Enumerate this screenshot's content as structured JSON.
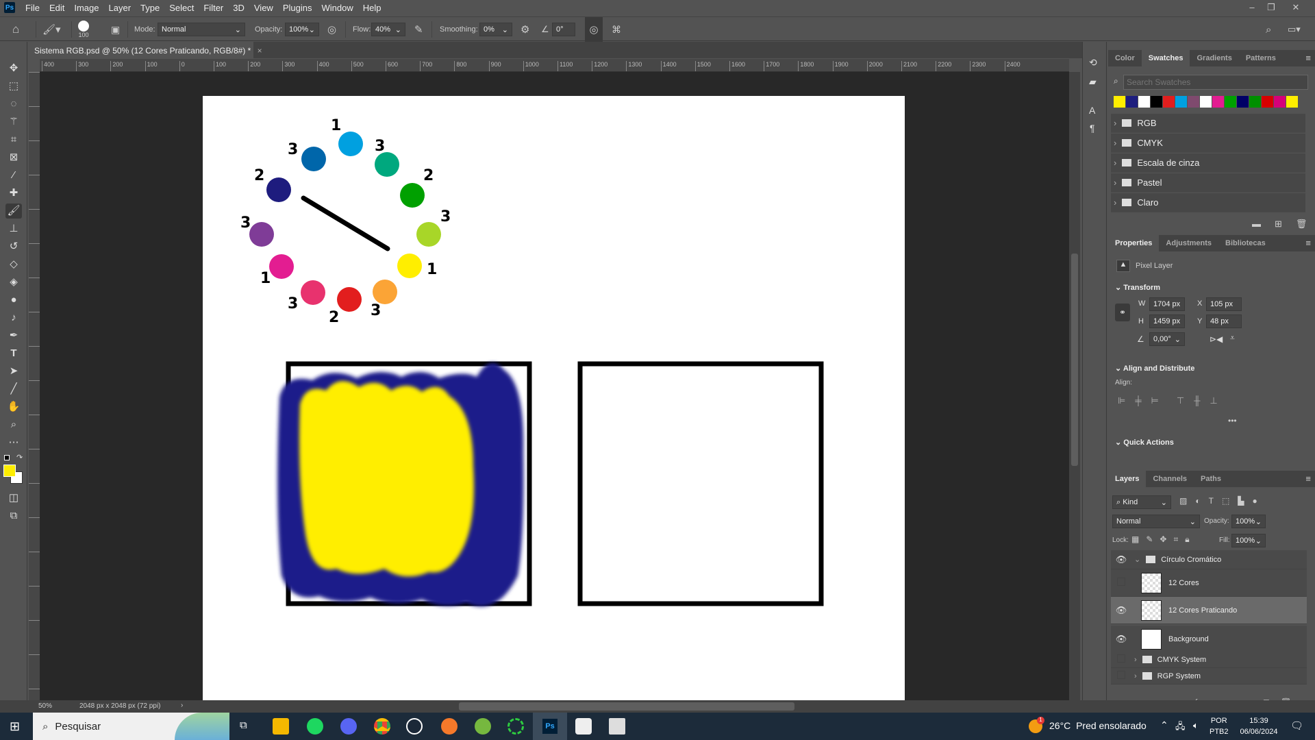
{
  "app": {
    "logo": "Ps",
    "menu": [
      "File",
      "Edit",
      "Image",
      "Layer",
      "Type",
      "Select",
      "Filter",
      "3D",
      "View",
      "Plugins",
      "Window",
      "Help"
    ]
  },
  "options": {
    "brush_size": "100",
    "mode_label": "Mode:",
    "mode": "Normal",
    "opacity_label": "Opacity:",
    "opacity": "100%",
    "flow_label": "Flow:",
    "flow": "40%",
    "smoothing_label": "Smoothing:",
    "smoothing": "0%",
    "angle": "0°"
  },
  "document": {
    "tab_title": "Sistema RGB.psd @ 50% (12 Cores Praticando, RGB/8#) *",
    "zoom": "50%",
    "info": "2048 px x 2048 px (72 ppi)"
  },
  "ruler": {
    "h_labels": [
      "400",
      "300",
      "200",
      "100",
      "0",
      "100",
      "200",
      "300",
      "400",
      "500",
      "600",
      "700",
      "800",
      "900",
      "1000",
      "1100",
      "1200",
      "1300",
      "1400",
      "1500",
      "1600",
      "1700",
      "1800",
      "1900",
      "2000",
      "2100",
      "2200",
      "2300",
      "2400"
    ]
  },
  "canvas": {
    "wheel": [
      {
        "color": "#00a0e0",
        "label": "1"
      },
      {
        "color": "#00a87e",
        "label": "3"
      },
      {
        "color": "#00a000",
        "label": "2"
      },
      {
        "color": "#a8d628",
        "label": "3"
      },
      {
        "color": "#ffee00",
        "label": "1"
      },
      {
        "color": "#fba436",
        "label": "3"
      },
      {
        "color": "#e21e1e",
        "label": "2"
      },
      {
        "color": "#e8326e",
        "label": "3"
      },
      {
        "color": "#e31d91",
        "label": "1"
      },
      {
        "color": "#7f3c97",
        "label": "3"
      },
      {
        "color": "#1e1c7e",
        "label": "2"
      },
      {
        "color": "#0066aa",
        "label": "3"
      }
    ],
    "paint_colors": {
      "primary": "#ffee00",
      "secondary": "#1e1e8a"
    }
  },
  "swatches_panel": {
    "tabs": [
      "Color",
      "Swatches",
      "Gradients",
      "Patterns"
    ],
    "active": "Swatches",
    "search_placeholder": "Search Swatches",
    "colors": [
      "#ffee00",
      "#1e1e7e",
      "#ffffff",
      "#000000",
      "#e21e1e",
      "#00a0e0",
      "#7f4a6e",
      "#ffffff",
      "#e31d91",
      "#00a000",
      "#000066",
      "#008f00",
      "#d80000",
      "#d6007a",
      "#ffee00"
    ],
    "groups": [
      "RGB",
      "CMYK",
      "Escala de cinza",
      "Pastel",
      "Claro"
    ]
  },
  "properties_panel": {
    "tabs": [
      "Properties",
      "Adjustments",
      "Bibliotecas"
    ],
    "active": "Properties",
    "layer_type": "Pixel Layer",
    "transform_title": "Transform",
    "w_label": "W",
    "w": "1704 px",
    "h_label": "H",
    "h": "1459 px",
    "x_label": "X",
    "x": "105 px",
    "y_label": "Y",
    "y": "48 px",
    "angle": "0,00°",
    "align_title": "Align and Distribute",
    "align_label": "Align:",
    "quick_actions": "Quick Actions"
  },
  "layers_panel": {
    "tabs": [
      "Layers",
      "Channels",
      "Paths"
    ],
    "active": "Layers",
    "kind": "Kind",
    "blend": "Normal",
    "opacity_label": "Opacity:",
    "opacity": "100%",
    "lock_label": "Lock:",
    "fill_label": "Fill:",
    "fill": "100%",
    "layers": [
      {
        "name": "Círculo Cromático",
        "type": "group",
        "visible": true,
        "expanded": true
      },
      {
        "name": "12 Cores",
        "type": "pixel",
        "visible": false
      },
      {
        "name": "12 Cores Praticando",
        "type": "pixel",
        "visible": true,
        "selected": true
      },
      {
        "name": "Background",
        "type": "pixel",
        "visible": true
      },
      {
        "name": "CMYK System",
        "type": "group",
        "visible": false
      },
      {
        "name": "RGP System",
        "type": "group",
        "visible": false
      }
    ]
  },
  "taskbar": {
    "search_placeholder": "Pesquisar",
    "weather_temp": "26°C",
    "weather_text": "Pred ensolarado",
    "weather_badge": "1",
    "lang1": "POR",
    "lang2": "PTB2",
    "time": "15:39",
    "date": "06/06/2024"
  }
}
